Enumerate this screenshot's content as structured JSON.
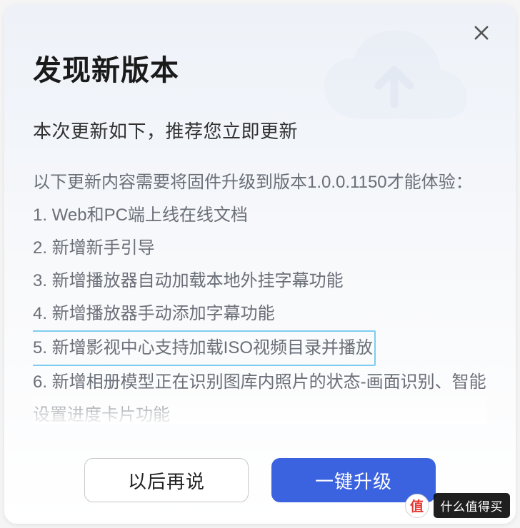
{
  "dialog": {
    "title": "发现新版本",
    "subtitle": "本次更新如下，推荐您立即更新",
    "version_note": "以下更新内容需要将固件升级到版本1.0.0.1150才能体验：",
    "changes": [
      "1. Web和PC端上线在线文档",
      "2. 新增新手引导",
      "3. 新增播放器自动加载本地外挂字幕功能",
      "4. 新增播放器手动添加字幕功能",
      "5. 新增影视中心支持加载ISO视频目录并播放",
      "6. 新增相册模型正在识别图库内照片的状态-画面识别、智能设置进度卡片功能"
    ],
    "highlighted_index": 4,
    "buttons": {
      "later": "以后再说",
      "upgrade": "一键升级"
    }
  },
  "watermark": {
    "badge": "值",
    "text": "什么值得买"
  }
}
